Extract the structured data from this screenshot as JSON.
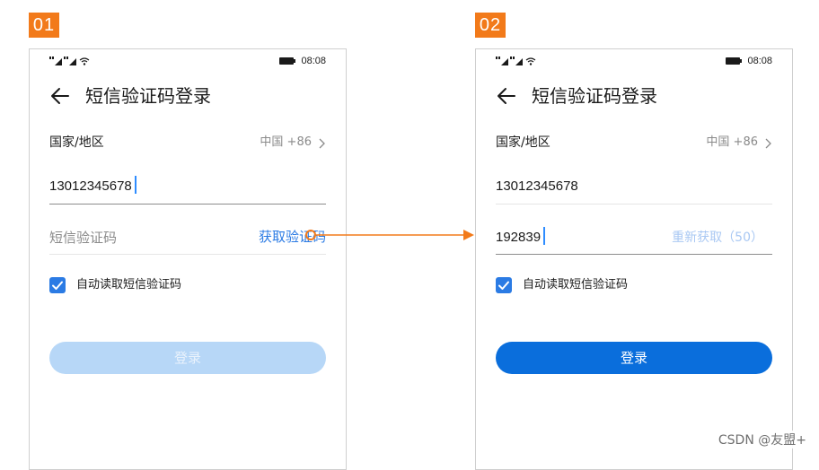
{
  "steps": [
    {
      "badge": "01",
      "status_bar": {
        "time": "08:08"
      },
      "title": "短信验证码登录",
      "region_row": {
        "label": "国家/地区",
        "value": "中国 +86"
      },
      "phone_field": {
        "value": "13012345678"
      },
      "code_field": {
        "placeholder": "短信验证码",
        "action_label": "获取验证码"
      },
      "auto_read": {
        "label": "自动读取短信验证码",
        "checked": true
      },
      "login_button": {
        "label": "登录",
        "state": "disabled"
      }
    },
    {
      "badge": "02",
      "status_bar": {
        "time": "08:08"
      },
      "title": "短信验证码登录",
      "region_row": {
        "label": "国家/地区",
        "value": "中国 +86"
      },
      "phone_field": {
        "value": "13012345678"
      },
      "code_field": {
        "value": "192839",
        "resend_label": "重新获取（50）"
      },
      "auto_read": {
        "label": "自动读取短信验证码",
        "checked": true
      },
      "login_button": {
        "label": "登录",
        "state": "enabled"
      }
    }
  ],
  "watermark": "CSDN @友盟+",
  "colors": {
    "accent": "#2b7be4",
    "badge": "#f27a1a",
    "button_enabled": "#0a6edc",
    "button_disabled": "#b7d7f7",
    "resend_text": "#a9c8f3"
  },
  "icons": [
    "back-arrow-icon",
    "chevron-right-icon",
    "signal-icon",
    "wifi-icon",
    "battery-icon",
    "checkmark-icon",
    "arrow-right-icon"
  ]
}
